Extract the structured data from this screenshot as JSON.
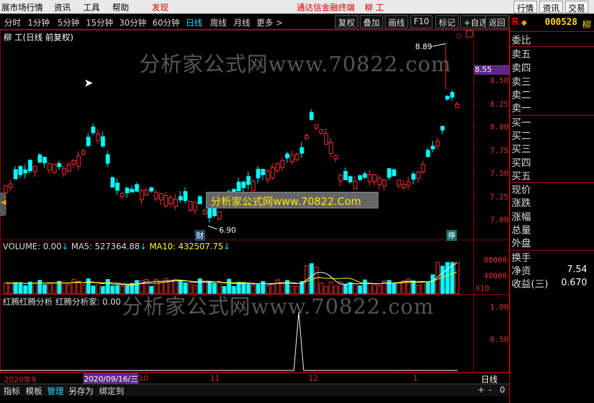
{
  "menubar": {
    "items": [
      "展市场行情",
      "资讯",
      "工具",
      "帮助",
      "发现"
    ],
    "center_title": "通达信金融终端",
    "stock_name": "柳 工",
    "right_buttons": [
      "行情",
      "资讯",
      "交易"
    ]
  },
  "toolbar": {
    "periods": [
      "分时",
      "1分钟",
      "5分钟",
      "15分钟",
      "30分钟",
      "60分钟",
      "日线",
      "周线",
      "月线",
      "更多 >"
    ],
    "active": "日线",
    "buttons": [
      "复权",
      "叠加",
      "画线",
      "F10",
      "标记",
      "+自选",
      "返回"
    ]
  },
  "main_chart": {
    "title": "柳 工(日线 前复权)",
    "price_axis": [
      "8.50",
      "8.25",
      "8.00",
      "7.75",
      "7.50",
      "7.25",
      "7.00"
    ],
    "current_price_tag": "8.55",
    "high_annotation": "8.89",
    "low_annotation": "6.90",
    "badge_cai": "财",
    "badge_ting": "停",
    "up_color": "#ff3232",
    "down_color": "#00ffff"
  },
  "volume_pane": {
    "volume_label": "VOLUME: 0.00",
    "ma5_label": "MA5: 527364.88",
    "ma10_label": "MA10: 432507.75",
    "axis": [
      "80000",
      "40000"
    ],
    "unit": "X10"
  },
  "indicator_pane": {
    "label": "红腾红腾分析 红腾分析家: 0.00",
    "axis": [
      "1.00",
      "0.50"
    ]
  },
  "time_axis": {
    "labels": [
      "2020年9",
      "10",
      "11",
      "12",
      "1"
    ],
    "cursor_date": "2020/09/16/三",
    "right_label": "日线"
  },
  "bottom_tabs": [
    "指标",
    "模板",
    "管理",
    "另存为",
    "绑定到"
  ],
  "bottom_controls": [
    "+",
    "-",
    "0"
  ],
  "watermarks": [
    "分析家公式网www.70822.com",
    "分析家公式网www.70822.Com",
    "分析家公式网www.70822.com"
  ],
  "right_panel": {
    "code": "000528",
    "code_suffix": "柳",
    "order_book_title": "委比",
    "sell_levels": [
      "卖五",
      "卖四",
      "卖三",
      "卖二",
      "卖一"
    ],
    "buy_levels": [
      "买一",
      "买二",
      "买三",
      "买四",
      "买五"
    ],
    "stats": [
      {
        "label": "现价",
        "value": ""
      },
      {
        "label": "涨跌",
        "value": ""
      },
      {
        "label": "涨幅",
        "value": ""
      },
      {
        "label": "总量",
        "value": ""
      },
      {
        "label": "外盘",
        "value": ""
      },
      {
        "label": "换手",
        "value": ""
      },
      {
        "label": "净资",
        "value": "7.54"
      },
      {
        "label": "收益(三)",
        "value": "0.670"
      }
    ]
  }
}
